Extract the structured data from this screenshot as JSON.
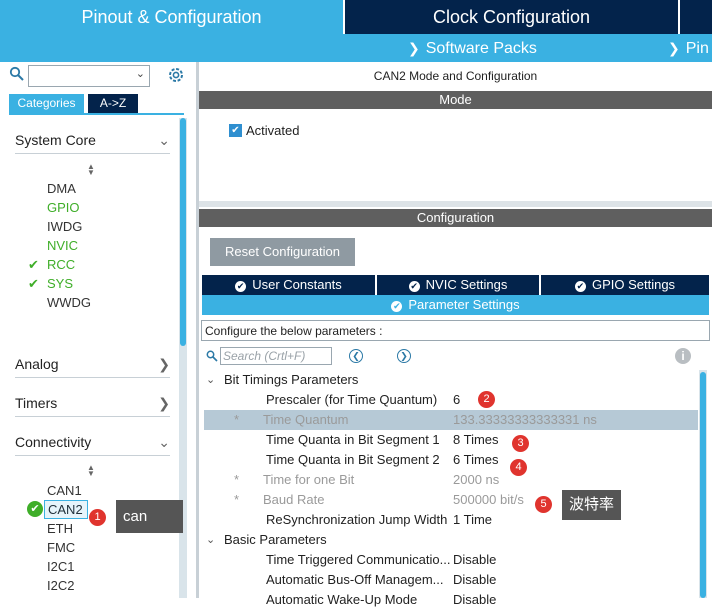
{
  "header": {
    "tab_pinout": "Pinout & Configuration",
    "tab_clock": "Clock Configuration",
    "software_packs": "Software Packs",
    "pinout_short": "Pin"
  },
  "left": {
    "search_value": "",
    "categories_label": "Categories",
    "az_label": "A->Z",
    "groups": {
      "system_core": "System Core",
      "analog": "Analog",
      "timers": "Timers",
      "connectivity": "Connectivity"
    },
    "system_core_items": [
      "DMA",
      "GPIO",
      "IWDG",
      "NVIC",
      "RCC",
      "SYS",
      "WWDG"
    ],
    "connectivity_items": [
      "CAN1",
      "CAN2",
      "ETH",
      "FMC",
      "I2C1",
      "I2C2"
    ],
    "can_tooltip": "can",
    "badge_1": "1"
  },
  "right": {
    "title": "CAN2 Mode and Configuration",
    "mode_label": "Mode",
    "activated_label": "Activated",
    "config_label": "Configuration",
    "reset_label": "Reset Configuration",
    "tabs": {
      "user_constants": "User Constants",
      "nvic_settings": "NVIC Settings",
      "gpio_settings": "GPIO Settings",
      "parameter_settings": "Parameter Settings"
    },
    "configure_text": "Configure the below parameters :",
    "search_placeholder": "Search (Crtl+F)",
    "bit_timings_header": "Bit Timings Parameters",
    "basic_params_header": "Basic Parameters",
    "params": [
      {
        "star": "",
        "name": "Prescaler (for Time Quantum)",
        "value": "6"
      },
      {
        "star": "*",
        "name": "Time Quantum",
        "value": "133.33333333333331 ns"
      },
      {
        "star": "",
        "name": "Time Quanta in Bit Segment 1",
        "value": "8 Times"
      },
      {
        "star": "",
        "name": "Time Quanta in Bit Segment 2",
        "value": "6 Times"
      },
      {
        "star": "*",
        "name": "Time for one Bit",
        "value": "2000 ns"
      },
      {
        "star": "*",
        "name": "Baud Rate",
        "value": "500000 bit/s"
      },
      {
        "star": "",
        "name": "ReSynchronization Jump Width",
        "value": "1 Time"
      }
    ],
    "basic_params": [
      {
        "name": "Time Triggered Communicatio...",
        "value": "Disable"
      },
      {
        "name": "Automatic Bus-Off Managem...",
        "value": "Disable"
      },
      {
        "name": "Automatic Wake-Up Mode",
        "value": "Disable"
      }
    ],
    "badges": [
      "2",
      "3",
      "4",
      "5"
    ],
    "baud_tooltip": "波特率"
  }
}
